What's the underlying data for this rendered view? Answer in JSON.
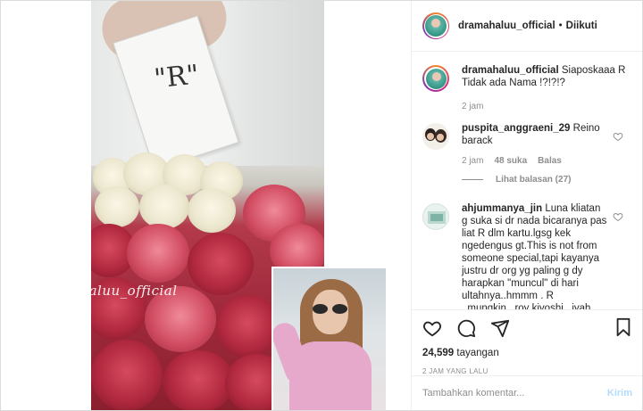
{
  "post": {
    "watermark_text": "@drmahaluu_official",
    "card_letter": "\"R\""
  },
  "header": {
    "username": "dramahaluu_official",
    "separator": "•",
    "follow_status": "Diikuti"
  },
  "comments": [
    {
      "username": "dramahaluu_official",
      "text": "Siaposkaaa R Tidak ada Nama !?!?!?",
      "time": "2 jam"
    },
    {
      "username": "puspita_anggraeni_29",
      "text": "Reino barack",
      "time": "2 jam",
      "likes": "48 suka",
      "reply_label": "Balas",
      "view_replies": "Lihat balasan (27)"
    },
    {
      "username": "ahjummanya_jin",
      "text": "Luna kliatan g suka si dr nada bicaranya pas liat R dlm kartu.lgsg kek ngedengus gt.This is not from someone special,tapi kayanya justru dr org yg paling g dy harapkan \"muncul\" di hari ultahnya..hmmm . R ..mungkin...roy kiyoshi...iyah pasti roy kiyoshi.si manusia indiehome"
    }
  ],
  "actions": {
    "icons": [
      "heart-icon",
      "comment-icon",
      "share-icon",
      "bookmark-icon"
    ],
    "views_count": "24,599",
    "views_label": "tayangan",
    "timestamp": "2 JAM YANG LALU"
  },
  "composer": {
    "placeholder": "Tambahkan komentar...",
    "post_label": "Kirim"
  },
  "colors": {
    "border": "#dbdbdb",
    "text": "#262626",
    "muted": "#8e8e8e",
    "post_disabled": "#b3dbff"
  }
}
